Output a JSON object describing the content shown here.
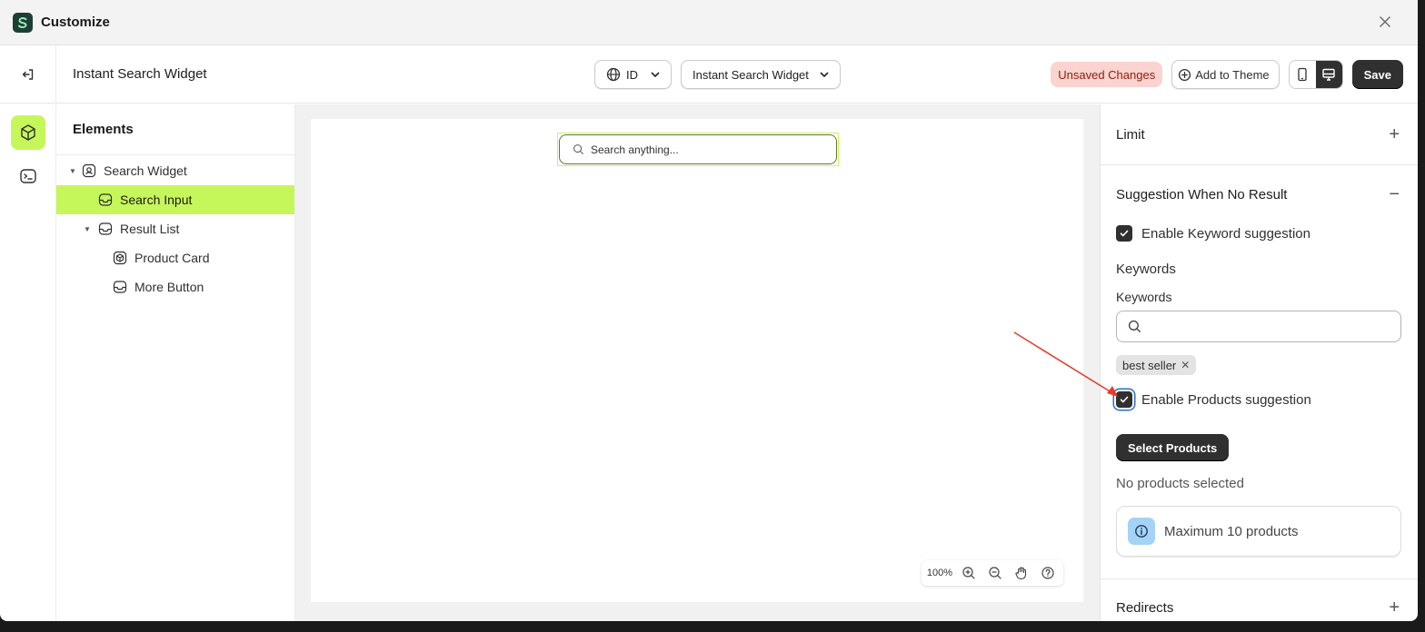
{
  "window": {
    "title": "Customize"
  },
  "toolbar": {
    "page_name": "Instant Search Widget",
    "language": "ID",
    "template": "Instant Search Widget",
    "unsaved": "Unsaved Changes",
    "add_to_theme": "Add to Theme",
    "save": "Save"
  },
  "tree": {
    "title": "Elements",
    "items": [
      {
        "label": "Search Widget"
      },
      {
        "label": "Search Input"
      },
      {
        "label": "Result List"
      },
      {
        "label": "Product Card"
      },
      {
        "label": "More Button"
      }
    ]
  },
  "canvas": {
    "search_placeholder": "Search anything...",
    "zoom": "100%"
  },
  "panel": {
    "limit": "Limit",
    "suggestion": "Suggestion When No Result",
    "enable_keyword": "Enable Keyword suggestion",
    "keywords_heading": "Keywords",
    "keywords_label": "Keywords",
    "tag": "best seller",
    "enable_products": "Enable Products suggestion",
    "select_products": "Select Products",
    "no_products": "No products selected",
    "max_products": "Maximum 10 products",
    "redirects": "Redirects"
  },
  "colors": {
    "accent": "#c6f75a",
    "dark": "#303030",
    "unsaved_bg": "#fbd3d0",
    "annotation_arrow": "#e53b2c"
  }
}
